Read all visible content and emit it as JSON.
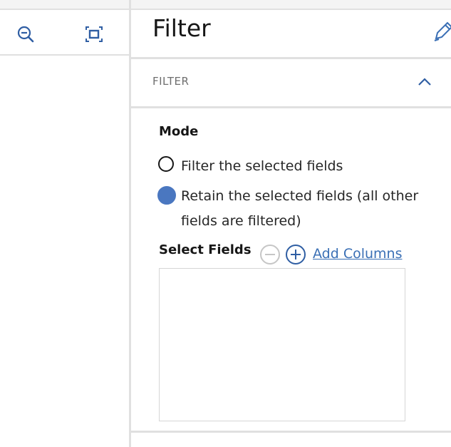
{
  "toolbar": {
    "zoom_out_icon": "zoom-out-icon",
    "fit_icon": "fit-to-screen-icon"
  },
  "panel": {
    "title": "Filter",
    "edit_icon": "pencil-icon"
  },
  "section": {
    "label": "FILTER",
    "expanded": true,
    "chevron_icon": "chevron-up-icon"
  },
  "mode": {
    "label": "Mode",
    "options": [
      {
        "label": "Filter the selected fields",
        "selected": false
      },
      {
        "label": "Retain the selected fields (all other fields are filtered)",
        "selected": true
      }
    ]
  },
  "select_fields": {
    "label": "Select Fields",
    "remove_icon": "minus-circle-icon",
    "add_icon": "plus-circle-icon",
    "add_columns_label": "Add Columns",
    "fields": []
  },
  "colors": {
    "accent": "#4a77c0",
    "link": "#3a6fb5",
    "icon": "#2f5ea3",
    "divider": "#e0e0e0",
    "muted_text": "#6f6f6f"
  }
}
